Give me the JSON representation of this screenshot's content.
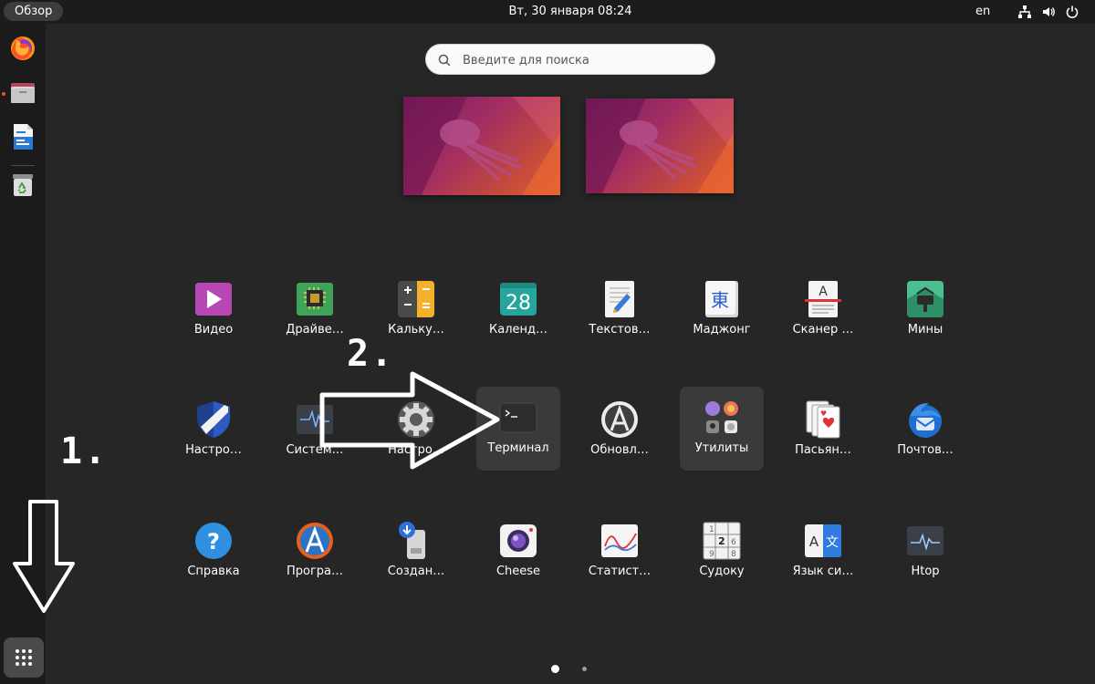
{
  "topbar": {
    "activities_label": "Обзор",
    "clock": "Вт, 30 января  08:24",
    "language": "en",
    "tray_icons": [
      "network-icon",
      "volume-icon",
      "power-icon"
    ]
  },
  "dock": {
    "items": [
      {
        "name": "firefox-icon",
        "running": false
      },
      {
        "name": "files-icon",
        "running": true
      },
      {
        "name": "writer-icon",
        "running": false
      },
      {
        "name": "trash-icon",
        "running": false
      }
    ],
    "show_apps_icon": "grid-icon"
  },
  "search": {
    "placeholder": "Введите для поиска"
  },
  "apps": {
    "row1": [
      "Видео",
      "Драйве…",
      "Кальку…",
      "Календ…",
      "Текстов…",
      "Маджонг",
      "Сканер …",
      "Мины"
    ],
    "row2": [
      "Настро…",
      "Систем…",
      "Настро…",
      "Терминал",
      "Обновл…",
      "Утилиты",
      "Пасьян…",
      "Почтов…"
    ],
    "row3": [
      "Справка",
      "Програ…",
      "Создан…",
      "Cheese",
      "Статист…",
      "Судоку",
      "Язык си…",
      "Htop"
    ],
    "calendar_day": "28"
  },
  "annotations": {
    "step1": "1.",
    "step2": "2."
  },
  "pagination": {
    "pages": 2,
    "current": 1
  },
  "colors": {
    "accent": "#e95420",
    "background": "#262626",
    "topbar": "#1c1c1c",
    "dock": "#1b1b1b"
  }
}
